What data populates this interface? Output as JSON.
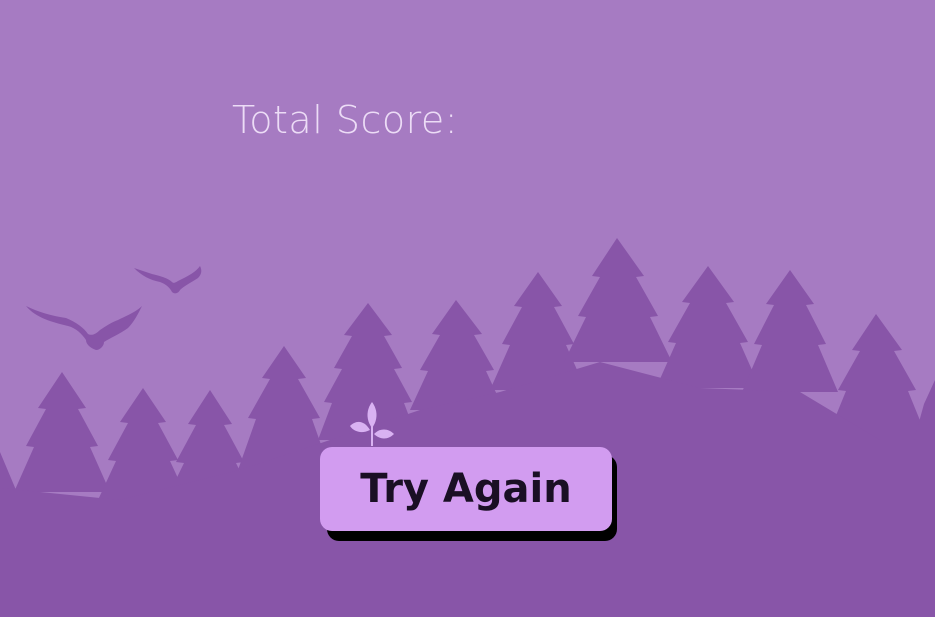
{
  "score": {
    "label": "Total Score:",
    "value": ""
  },
  "actions": {
    "try_again_label": "Try Again"
  },
  "colors": {
    "sky": "#a67bc2",
    "trees": "#8855a8",
    "button": "#d29cf0",
    "button_shadow": "#000000",
    "score_text": "#ecdcf6",
    "sprout": "#d9b2f2"
  },
  "icons": {
    "birds": "bird-silhouette-icon",
    "sprout": "sprout-icon"
  }
}
